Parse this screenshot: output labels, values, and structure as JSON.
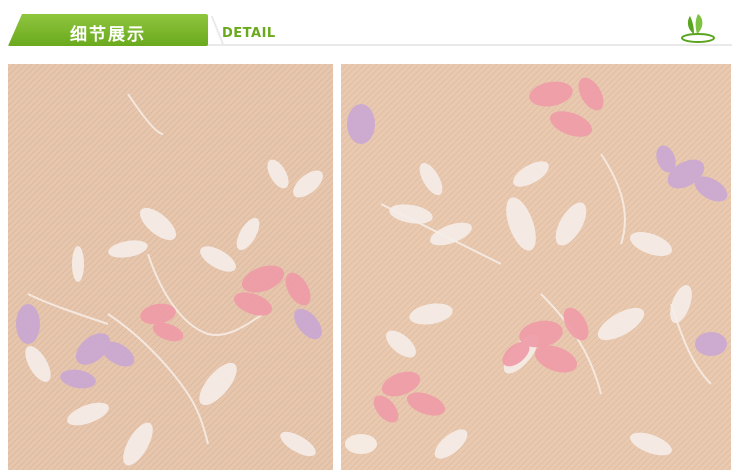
{
  "header": {
    "title": "细节展示",
    "subtitle": "DETAIL",
    "logo_icon": "leaf-logo-icon",
    "accent_color": "#7ab82b"
  },
  "images": [
    {
      "alt": "wallpaper-detail-left"
    },
    {
      "alt": "wallpaper-detail-right"
    }
  ],
  "colors": {
    "background": "#e8c8b0",
    "pink_flower": "#ef9aa6",
    "lilac_flower": "#c8a6d6",
    "leaf": "#f6eee9"
  }
}
